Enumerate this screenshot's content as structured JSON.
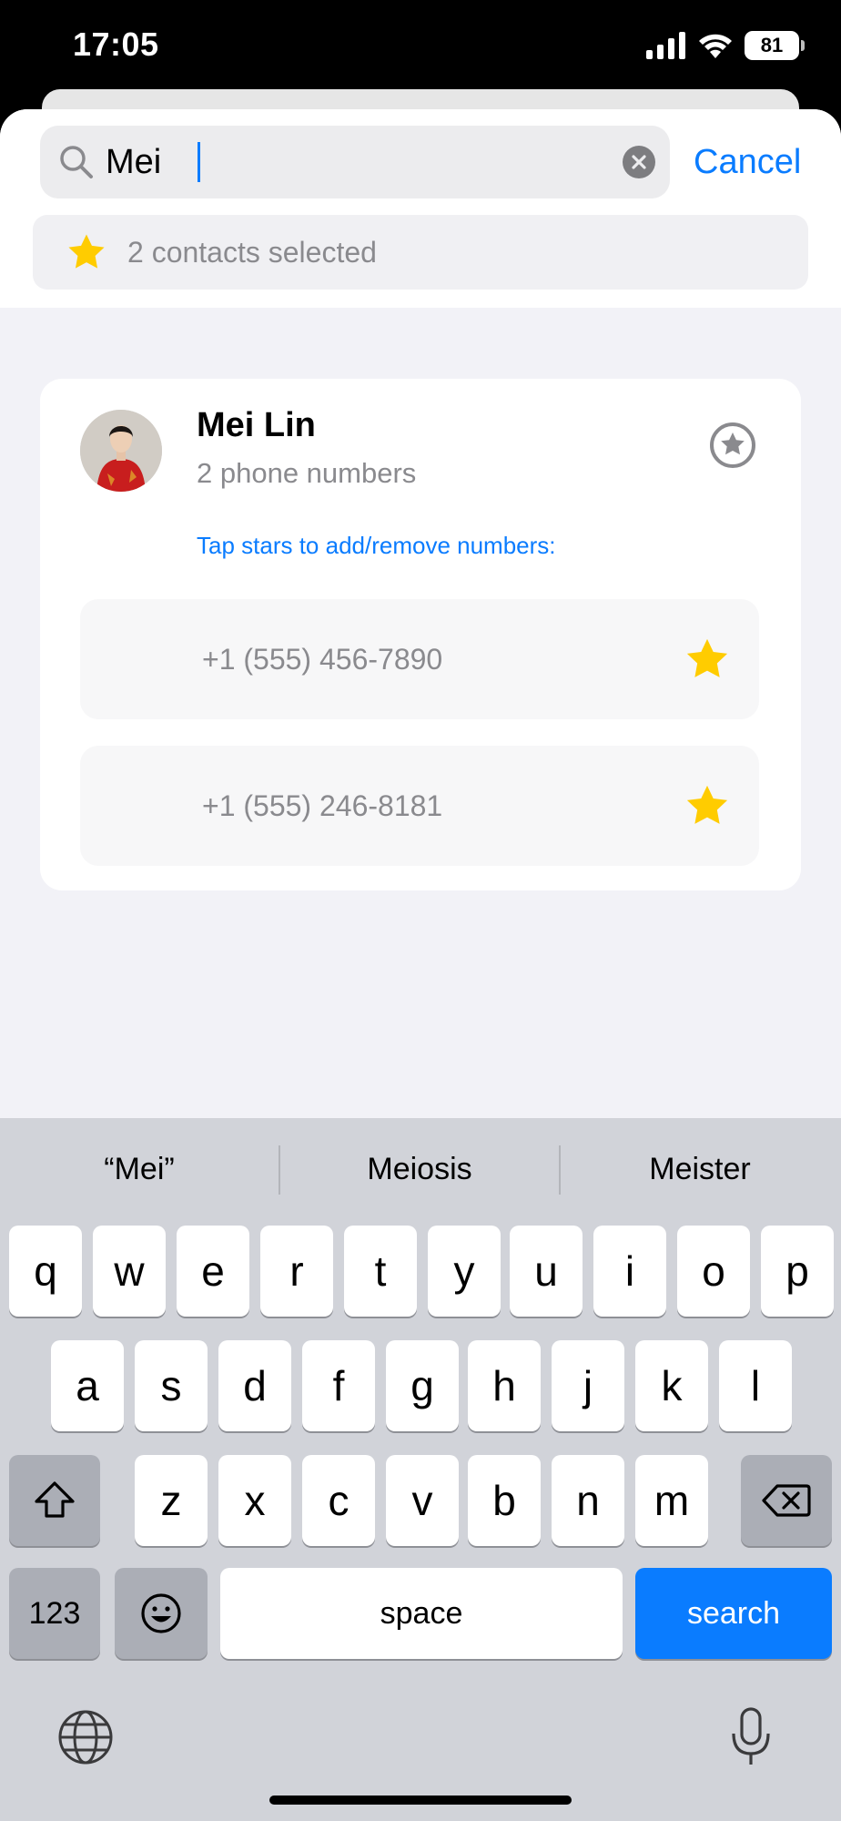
{
  "status_bar": {
    "time": "17:05",
    "battery": "81"
  },
  "search": {
    "query": "Mei",
    "cancel_label": "Cancel"
  },
  "selection": {
    "text": "2 contacts selected"
  },
  "contact": {
    "name": "Mei Lin",
    "subtitle": "2 phone numbers",
    "hint": "Tap stars to add/remove numbers:",
    "numbers": [
      {
        "number": "+1 (555) 456-7890",
        "starred": true
      },
      {
        "number": "+1 (555) 246-8181",
        "starred": true
      }
    ]
  },
  "keyboard": {
    "suggestions": [
      "“Mei”",
      "Meiosis",
      "Meister"
    ],
    "row1": [
      "q",
      "w",
      "e",
      "r",
      "t",
      "y",
      "u",
      "i",
      "o",
      "p"
    ],
    "row2": [
      "a",
      "s",
      "d",
      "f",
      "g",
      "h",
      "j",
      "k",
      "l"
    ],
    "row3": [
      "z",
      "x",
      "c",
      "v",
      "b",
      "n",
      "m"
    ],
    "numbers_label": "123",
    "space_label": "space",
    "search_label": "search"
  },
  "colors": {
    "accent": "#0a7cff",
    "star": "#ffcc00",
    "keyboard_bg": "#d1d3d9"
  }
}
